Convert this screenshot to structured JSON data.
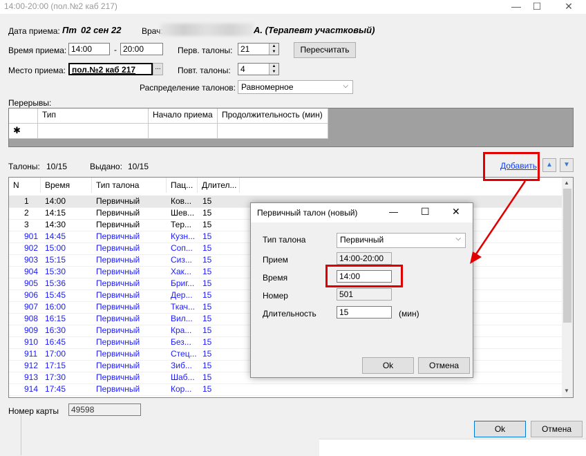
{
  "window": {
    "title": "14:00-20:00 (пол.№2 каб 217)",
    "minimize_glyph": "—",
    "maximize_glyph": "☐",
    "close_glyph": "✕"
  },
  "form": {
    "date_label": "Дата приема:",
    "date_day": "Пт",
    "date_value": "02 сен 22",
    "doctor_label": "Врач:",
    "doctor_tail": "А. (Терапевт участковый)",
    "time_label": "Время приема:",
    "time_from": "14:00",
    "time_dash": "-",
    "time_to": "20:00",
    "first_tickets_label": "Перв. талоны:",
    "first_tickets_value": "21",
    "recalc_label": "Пересчитать",
    "place_label": "Место приема:",
    "place_value": "пол.№2 каб 217",
    "place_browse": "...",
    "repeat_tickets_label": "Повт. талоны:",
    "repeat_tickets_value": "4",
    "distribution_label": "Распределение талонов:",
    "distribution_value": "Равномерное"
  },
  "breaks": {
    "label": "Перерывы:",
    "headers": [
      "Тип",
      "Начало приема",
      "Продолжительность (мин)"
    ],
    "new_row_marker": "✱"
  },
  "tickets": {
    "count_label": "Талоны:",
    "count_value": "10/15",
    "issued_label": "Выдано:",
    "issued_value": "10/15",
    "add_link": "Добавить",
    "up_icon": "▲",
    "down_icon": "▼",
    "headers": [
      "N",
      "Время",
      "Тип талона",
      "Пац...",
      "Длител..."
    ],
    "rows": [
      {
        "n": "1",
        "time": "14:00",
        "type": "Первичный",
        "pat": "Ков...",
        "dur": "15",
        "blue": false,
        "sel": true
      },
      {
        "n": "2",
        "time": "14:15",
        "type": "Первичный",
        "pat": "Шев...",
        "dur": "15",
        "blue": false,
        "sel": false
      },
      {
        "n": "3",
        "time": "14:30",
        "type": "Первичный",
        "pat": "Тер...",
        "dur": "15",
        "blue": false,
        "sel": false
      },
      {
        "n": "901",
        "time": "14:45",
        "type": "Первичный",
        "pat": "Кузн...",
        "dur": "15",
        "blue": true,
        "sel": false
      },
      {
        "n": "902",
        "time": "15:00",
        "type": "Первичный",
        "pat": "Соп...",
        "dur": "15",
        "blue": true,
        "sel": false
      },
      {
        "n": "903",
        "time": "15:15",
        "type": "Первичный",
        "pat": "Сиз...",
        "dur": "15",
        "blue": true,
        "sel": false
      },
      {
        "n": "904",
        "time": "15:30",
        "type": "Первичный",
        "pat": "Хак...",
        "dur": "15",
        "blue": true,
        "sel": false
      },
      {
        "n": "905",
        "time": "15:36",
        "type": "Первичный",
        "pat": "Бриг...",
        "dur": "15",
        "blue": true,
        "sel": false
      },
      {
        "n": "906",
        "time": "15:45",
        "type": "Первичный",
        "pat": "Дер...",
        "dur": "15",
        "blue": true,
        "sel": false
      },
      {
        "n": "907",
        "time": "16:00",
        "type": "Первичный",
        "pat": "Ткач...",
        "dur": "15",
        "blue": true,
        "sel": false
      },
      {
        "n": "908",
        "time": "16:15",
        "type": "Первичный",
        "pat": "Вил...",
        "dur": "15",
        "blue": true,
        "sel": false
      },
      {
        "n": "909",
        "time": "16:30",
        "type": "Первичный",
        "pat": "Кра...",
        "dur": "15",
        "blue": true,
        "sel": false
      },
      {
        "n": "910",
        "time": "16:45",
        "type": "Первичный",
        "pat": "Без...",
        "dur": "15",
        "blue": true,
        "sel": false
      },
      {
        "n": "911",
        "time": "17:00",
        "type": "Первичный",
        "pat": "Стец...",
        "dur": "15",
        "blue": true,
        "sel": false
      },
      {
        "n": "912",
        "time": "17:15",
        "type": "Первичный",
        "pat": "Зиб...",
        "dur": "15",
        "blue": true,
        "sel": false
      },
      {
        "n": "913",
        "time": "17:30",
        "type": "Первичный",
        "pat": "Шаб...",
        "dur": "15",
        "blue": true,
        "sel": false
      },
      {
        "n": "914",
        "time": "17:45",
        "type": "Первичный",
        "pat": "Кор...",
        "dur": "15",
        "blue": true,
        "sel": false
      }
    ]
  },
  "card": {
    "label": "Номер карты",
    "value": "49598"
  },
  "footer": {
    "ok_label": "Ok",
    "cancel_label": "Отмена"
  },
  "dialog": {
    "title": "Первичный талон (новый)",
    "type_label": "Тип талона",
    "type_value": "Первичный",
    "reception_label": "Прием",
    "reception_value": "14:00-20:00",
    "time_label": "Время",
    "time_value": "14:00",
    "number_label": "Номер",
    "number_value": "501",
    "duration_label": "Длительность",
    "duration_value": "15",
    "duration_unit": "(мин)",
    "ok_label": "Ok",
    "cancel_label": "Отмена"
  },
  "colors": {
    "annotation_red": "#e10000",
    "link_blue": "#0b3cff",
    "row_blue": "#1a1aff"
  }
}
